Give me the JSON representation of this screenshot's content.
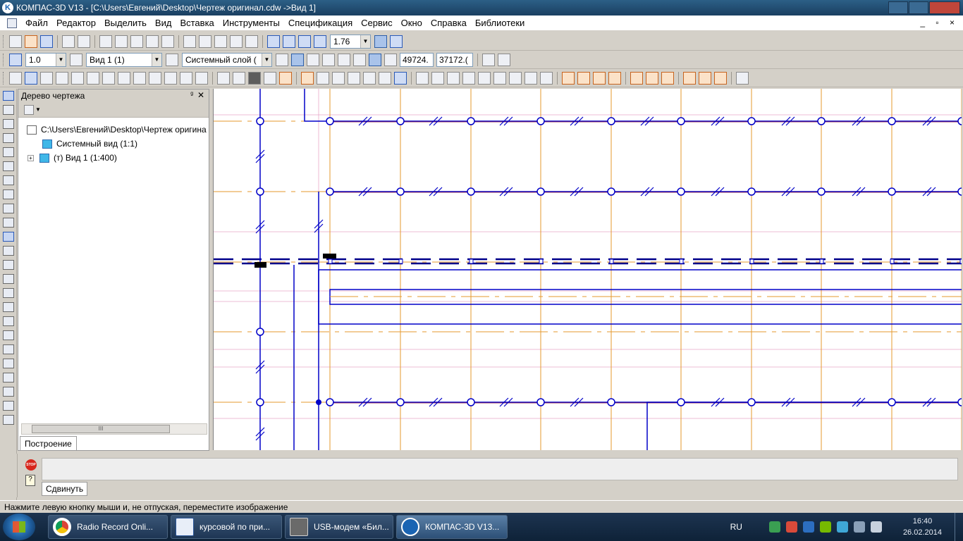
{
  "window": {
    "title": "КОМПАС-3D V13 - [C:\\Users\\Евгений\\Desktop\\Чертеж оригинал.cdw ->Вид 1]"
  },
  "menu": {
    "items": [
      "Файл",
      "Редактор",
      "Выделить",
      "Вид",
      "Вставка",
      "Инструменты",
      "Спецификация",
      "Сервис",
      "Окно",
      "Справка",
      "Библиотеки"
    ],
    "mdi_controls": "_ ▫ ×"
  },
  "toolbar_standard": {
    "zoom_value": "1.76"
  },
  "toolbar_current_state": {
    "step_value": "1.0",
    "view_value": "Вид 1 (1)",
    "layer_value": "Системный слой (",
    "coord_x": "49724.",
    "coord_y": "37172.("
  },
  "tree_panel": {
    "title": "Дерево чертежа",
    "pin_glyph": "ᵍ",
    "close_glyph": "✕",
    "nodes": [
      {
        "label": "C:\\Users\\Евгений\\Desktop\\Чертеж оригина"
      },
      {
        "label": "Системный вид (1:1)"
      },
      {
        "label": "(т) Вид 1 (1:400)",
        "expander": "+"
      }
    ],
    "scroll_thumb_grip": "III",
    "tab_label": "Построение"
  },
  "properties_panel": {
    "stop_label": "STOP",
    "help_glyph": "?",
    "tab_label": "Сдвинуть"
  },
  "status_bar": {
    "message": "Нажмите левую кнопку мыши и, не отпуская, переместите изображение"
  },
  "taskbar": {
    "tasks": [
      {
        "label": "Radio Record Onli...",
        "icon": "chrome-icon"
      },
      {
        "label": "курсовой по при...",
        "icon": "word-icon"
      },
      {
        "label": "USB-модем «Бил...",
        "icon": "modem-icon"
      },
      {
        "label": "КОМПАС-3D V13...",
        "icon": "kompas-icon"
      }
    ],
    "language": "RU",
    "time": "16:40",
    "date": "26.02.2014"
  },
  "colors": {
    "drawing_blue": "#0000c8",
    "axis_orange": "#e69a2e",
    "grid_pink": "#e8a8c8",
    "accent_dark_red": "#800030"
  }
}
